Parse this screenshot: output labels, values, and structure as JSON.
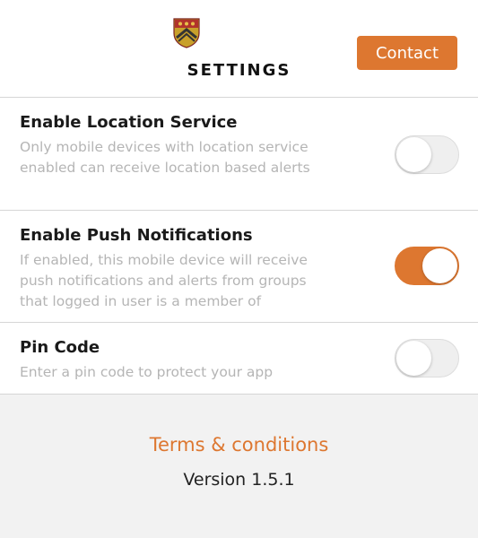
{
  "header": {
    "title": "SETTINGS",
    "contact_label": "Contact",
    "crest_icon": "university-crest-icon"
  },
  "settings": [
    {
      "title": "Enable Location Service",
      "description": "Only mobile devices with location service enabled can receive location based alerts",
      "enabled": false
    },
    {
      "title": "Enable Push Notifications",
      "description": "If enabled, this mobile device will receive push notifications and alerts from groups that logged in user is a member of",
      "enabled": true
    },
    {
      "title": "Pin Code",
      "description": "Enter a pin code to protect your app",
      "enabled": false
    }
  ],
  "footer": {
    "terms_label": "Terms & conditions",
    "version": "Version 1.5.1"
  },
  "colors": {
    "accent": "#dd7730",
    "toggle_off": "#efefef",
    "divider": "#d6d6d6",
    "background": "#f2f2f2"
  }
}
